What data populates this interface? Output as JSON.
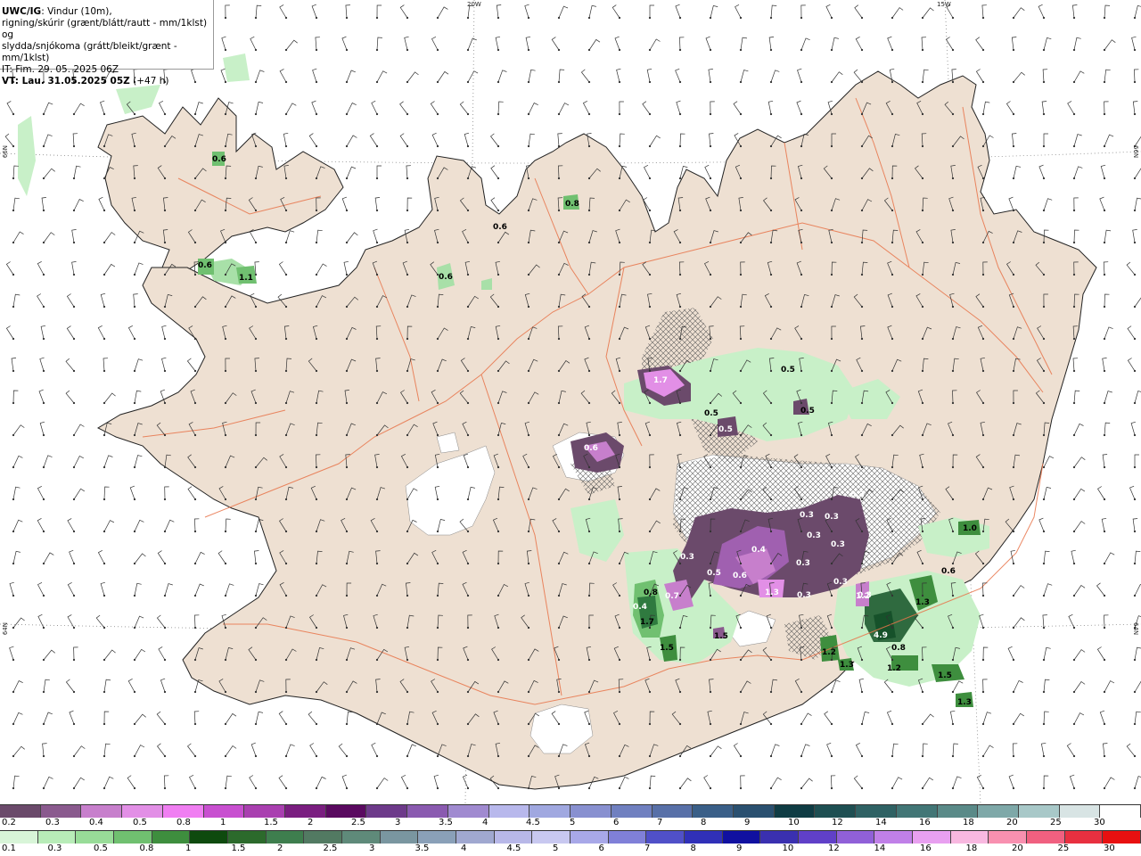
{
  "title": {
    "model": "UWC/IG",
    "line1": ": Vindur (10m),",
    "line2": "rigning/skúrir (grænt/blátt/rautt - mm/1klst) og",
    "line3": "slydda/snjókoma (grátt/bleikt/grænt - mm/1klst)",
    "it": "IT: Fim. 29. 05. 2025 06Z",
    "vt_label": "VT: Lau. 31.05.2025 05Z",
    "vt_offset": "(+47 h)"
  },
  "graticule": {
    "lon_20w": "20W",
    "lon_15w": "15W",
    "lat_66n_left": "66N",
    "lat_66n_right": "66N",
    "lat_64n_left": "64N",
    "lat_64n_right": "64N"
  },
  "colorbar_snow": {
    "colors": [
      "#6b4a6b",
      "#8a5a8e",
      "#c77fcc",
      "#e28fe6",
      "#f07ef2",
      "#c84fd0",
      "#a93fb0",
      "#7a1e80",
      "#5a0a60",
      "#6d3a8a",
      "#8a5ab0",
      "#a08ad0",
      "#b8b8ec",
      "#a0a8e0",
      "#8890d0",
      "#7080c0",
      "#5870a8",
      "#3a5f88",
      "#2a5070",
      "#0f3c44",
      "#1e4f52",
      "#2f6264",
      "#427676",
      "#5a8a88",
      "#7ea8a8",
      "#a8c8c8",
      "#d8e4e4",
      "#ffffff"
    ],
    "labels": [
      "0.2",
      "0.3",
      "0.4",
      "0.5",
      "0.8",
      "1",
      "1.5",
      "2",
      "2.5",
      "3",
      "3.5",
      "4",
      "4.5",
      "5",
      "6",
      "7",
      "8",
      "9",
      "10",
      "12",
      "14",
      "16",
      "18",
      "20",
      "25",
      "30"
    ]
  },
  "colorbar_rain": {
    "colors": [
      "#d8f5d8",
      "#b8ecb8",
      "#98dc98",
      "#70c070",
      "#3e8e3e",
      "#0e4a0e",
      "#2c6a2c",
      "#3e7e4e",
      "#527a62",
      "#5f8a7a",
      "#7a96a0",
      "#8aa0b8",
      "#a0a8d0",
      "#b8b8e8",
      "#c8c8f0",
      "#a8a8e8",
      "#8080d8",
      "#5050c8",
      "#3030b8",
      "#1010a0",
      "#3a30b0",
      "#6040c8",
      "#9060d8",
      "#c080e8",
      "#e8a0f0",
      "#f8b8e0",
      "#f890b0",
      "#f06080",
      "#e83040",
      "#e81010"
    ],
    "labels": [
      "0.1",
      "0.3",
      "0.5",
      "0.8",
      "1",
      "1.5",
      "2",
      "2.5",
      "3",
      "3.5",
      "4",
      "4.5",
      "5",
      "6",
      "7",
      "8",
      "9",
      "10",
      "12",
      "14",
      "16",
      "18",
      "20",
      "25",
      "30"
    ]
  },
  "precip_labels": [
    {
      "text": "0.6",
      "dark": true
    },
    {
      "text": "0.6",
      "dark": true
    },
    {
      "text": "1.1",
      "dark": true
    },
    {
      "text": "0.6",
      "dark": true
    },
    {
      "text": "0.6",
      "dark": true
    },
    {
      "text": "0.8",
      "dark": true
    },
    {
      "text": "1.7",
      "dark": false
    },
    {
      "text": "0.5",
      "dark": true
    },
    {
      "text": "0.5",
      "dark": true
    },
    {
      "text": "0.5",
      "dark": false
    },
    {
      "text": "0.5",
      "dark": true
    },
    {
      "text": "0.6",
      "dark": false
    },
    {
      "text": "0.3",
      "dark": false
    },
    {
      "text": "0.3",
      "dark": false
    },
    {
      "text": "0.3",
      "dark": false
    },
    {
      "text": "0.3",
      "dark": false
    },
    {
      "text": "0.3",
      "dark": false
    },
    {
      "text": "0.3",
      "dark": false
    },
    {
      "text": "0.4",
      "dark": false
    },
    {
      "text": "0.3",
      "dark": false
    },
    {
      "text": "0.3",
      "dark": false
    },
    {
      "text": "0.5",
      "dark": false
    },
    {
      "text": "0.6",
      "dark": false
    },
    {
      "text": "1.3",
      "dark": false
    },
    {
      "text": "0.3",
      "dark": false
    },
    {
      "text": "0.3",
      "dark": false
    },
    {
      "text": "0.8",
      "dark": true
    },
    {
      "text": "0.7",
      "dark": false
    },
    {
      "text": "0.4",
      "dark": false
    },
    {
      "text": "1.7",
      "dark": true
    },
    {
      "text": "1.5",
      "dark": true
    },
    {
      "text": "1.5",
      "dark": true
    },
    {
      "text": "1.0",
      "dark": true
    },
    {
      "text": "0.6",
      "dark": true
    },
    {
      "text": "1.3",
      "dark": true
    },
    {
      "text": "4.9",
      "dark": false
    },
    {
      "text": "0.8",
      "dark": true
    },
    {
      "text": "1.2",
      "dark": true
    },
    {
      "text": "1.5",
      "dark": true
    },
    {
      "text": "1.3",
      "dark": true
    },
    {
      "text": "1.2",
      "dark": true
    },
    {
      "text": "1.3",
      "dark": true
    },
    {
      "text": "1.2",
      "dark": false
    }
  ]
}
